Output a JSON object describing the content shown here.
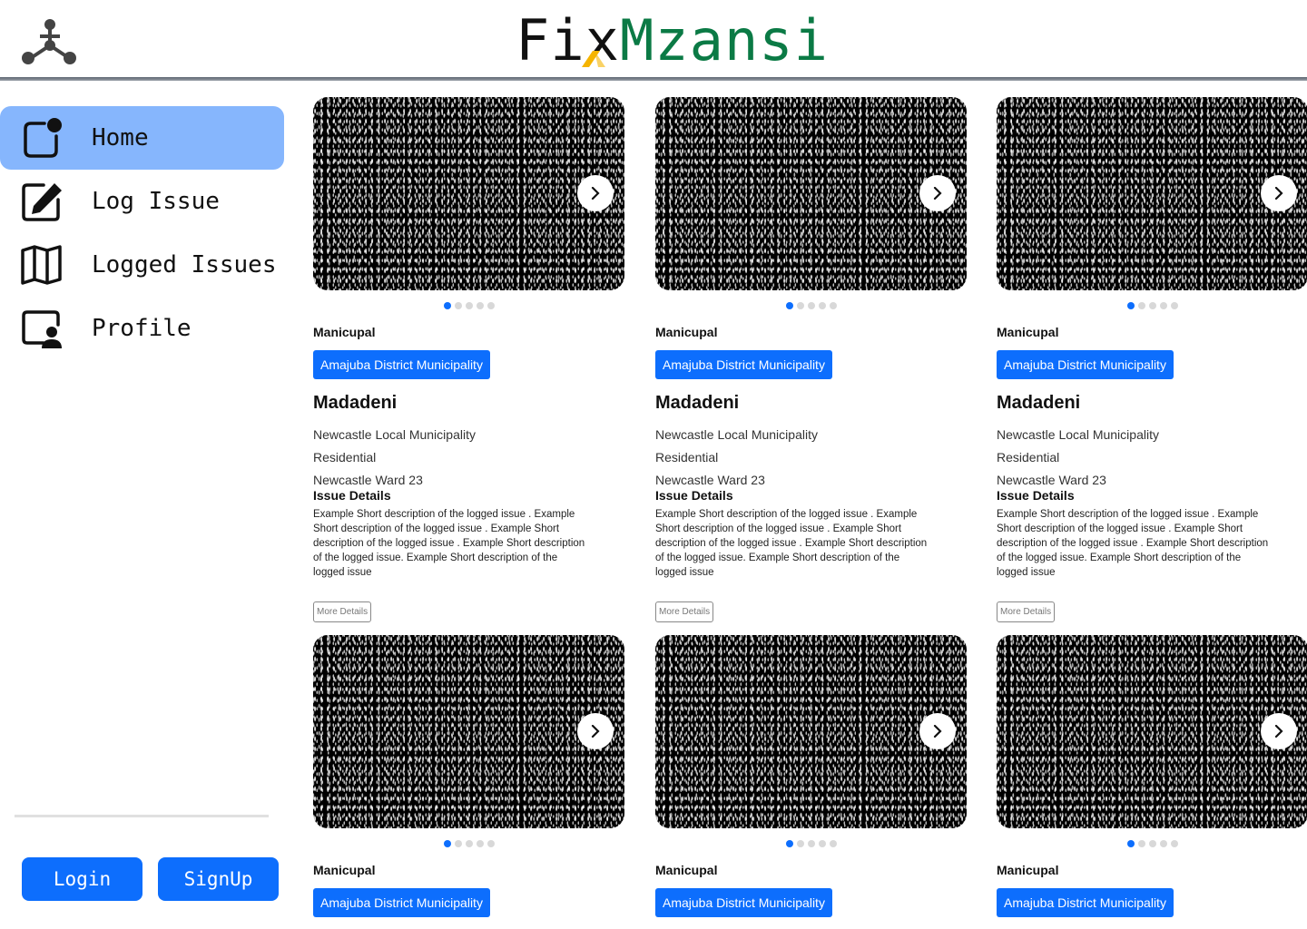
{
  "header": {
    "brand_fix": "Fi",
    "brand_x": "x",
    "brand_mzansi": "Mzansi",
    "brand_color_dark": "#111111",
    "brand_color_green": "#0b7a45",
    "brand_color_gold": "#f5b400"
  },
  "sidebar": {
    "items": [
      {
        "label": "Home",
        "icon": "home-app-icon",
        "active": true
      },
      {
        "label": "Log Issue",
        "icon": "edit-icon",
        "active": false
      },
      {
        "label": "Logged Issues",
        "icon": "map-icon",
        "active": false
      },
      {
        "label": "Profile",
        "icon": "profile-icon",
        "active": false
      }
    ],
    "active_color": "#86b6fd",
    "login_label": "Login",
    "signup_label": "SignUp"
  },
  "cards": [
    {
      "category": "Manicupal",
      "badge": "Amajuba District Municipality",
      "title": "Madadeni",
      "municipality": "Newcastle Local Municipality",
      "zone": "Residential",
      "ward": "Newcastle Ward 23",
      "details_heading": "Issue Details",
      "description": "Example Short description of the logged issue . Example Short description of the logged issue . Example Short description of the logged issue . Example Short description of the logged issue. Example Short description of the logged issue",
      "more_label": "More Details",
      "slides": 5,
      "active_slide": 1
    },
    {
      "category": "Manicupal",
      "badge": "Amajuba District Municipality",
      "title": "Madadeni",
      "municipality": "Newcastle Local Municipality",
      "zone": "Residential",
      "ward": "Newcastle Ward 23",
      "details_heading": "Issue Details",
      "description": "Example Short description of the logged issue . Example Short description of the logged issue . Example Short description of the logged issue . Example Short description of the logged issue. Example Short description of the logged issue",
      "more_label": "More Details",
      "slides": 5,
      "active_slide": 1
    },
    {
      "category": "Manicupal",
      "badge": "Amajuba District Municipality",
      "title": "Madadeni",
      "municipality": "Newcastle Local Municipality",
      "zone": "Residential",
      "ward": "Newcastle Ward 23",
      "details_heading": "Issue Details",
      "description": "Example Short description of the logged issue . Example Short description of the logged issue . Example Short description of the logged issue . Example Short description of the logged issue. Example Short description of the logged issue",
      "more_label": "More Details",
      "slides": 5,
      "active_slide": 1
    },
    {
      "category": "Manicupal",
      "badge": "Amajuba District Municipality",
      "slides": 5,
      "active_slide": 1
    },
    {
      "category": "Manicupal",
      "badge": "Amajuba District Municipality",
      "slides": 5,
      "active_slide": 1
    },
    {
      "category": "Manicupal",
      "badge": "Amajuba District Municipality",
      "slides": 5,
      "active_slide": 1
    }
  ],
  "colors": {
    "primary": "#0d6efd",
    "divider": "#e0e0e0",
    "dot_inactive": "#d8d8d8"
  }
}
